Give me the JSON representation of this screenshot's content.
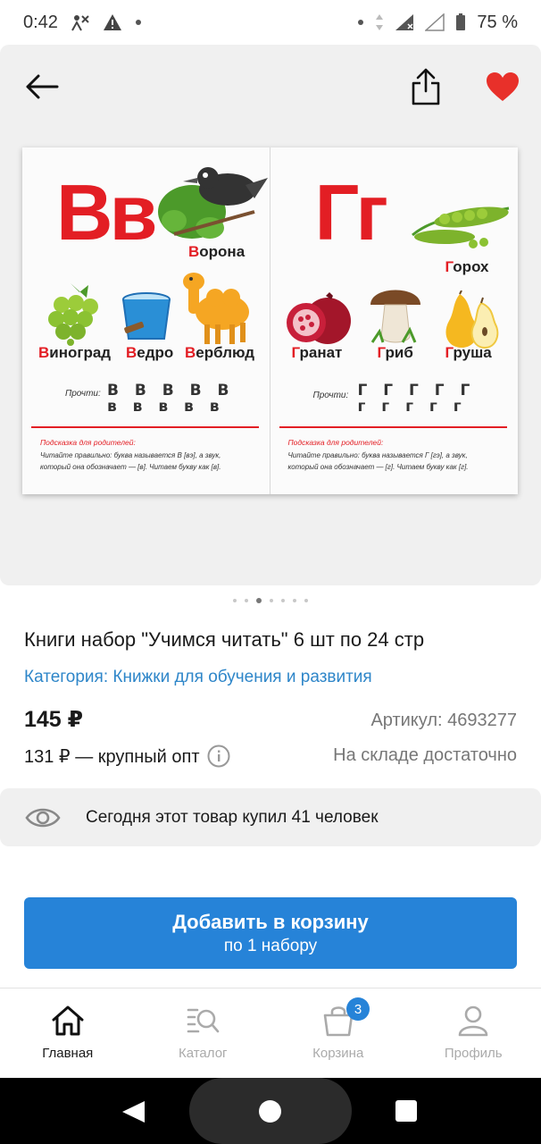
{
  "status": {
    "time": "0:42",
    "battery": "75 %"
  },
  "book": {
    "left": {
      "letter": "Вв",
      "w_top": {
        "first": "В",
        "rest": "орона"
      },
      "w1": {
        "first": "В",
        "rest": "иноград"
      },
      "w2": {
        "first": "В",
        "rest": "едро"
      },
      "w3": {
        "first": "В",
        "rest": "ерблюд"
      },
      "read_label": "Прочти:",
      "read_row1": "В В В В В",
      "read_row2": "в в в в в",
      "hint_title": "Подсказка для родителей:",
      "hint_line1": "Читайте правильно: буква называется В [вэ], а звук,",
      "hint_line2": "который она обозначает — [в]. Читаем букву как [в]."
    },
    "right": {
      "letter": "Гг",
      "w_top": {
        "first": "Г",
        "rest": "орох"
      },
      "w1": {
        "first": "Г",
        "rest": "ранат"
      },
      "w2": {
        "first": "Г",
        "rest": "риб"
      },
      "w3": {
        "first": "Г",
        "rest": "руша"
      },
      "read_label": "Прочти:",
      "read_row1": "Г Г Г Г Г",
      "read_row2": "г г г г г",
      "hint_title": "Подсказка для родителей:",
      "hint_line1": "Читайте правильно: буква называется Г [гэ], а звук,",
      "hint_line2": "который она обозначает — [г]. Читаем букву как [г]."
    }
  },
  "gallery": {
    "dots_total": 7,
    "active_index": 2
  },
  "product": {
    "title": "Книги набор \"Учимся читать\" 6 шт по 24 стр",
    "category": "Категория: Книжки для обучения и развития",
    "price": "145 ₽",
    "article": "Артикул: 4693277",
    "wholesale": "131 ₽ — крупный опт",
    "stock": "На складе достаточно",
    "bought_today": "Сегодня этот товар купил 41 человек"
  },
  "add_to_cart": {
    "line1": "Добавить в корзину",
    "line2": "по 1 набору"
  },
  "nav": {
    "home": "Главная",
    "catalog": "Каталог",
    "cart": "Корзина",
    "cart_count": "3",
    "profile": "Профиль"
  },
  "colors": {
    "accent": "#2683d8",
    "link": "#2e86c9",
    "heart": "#e8302a",
    "book_red": "#e31e24"
  }
}
